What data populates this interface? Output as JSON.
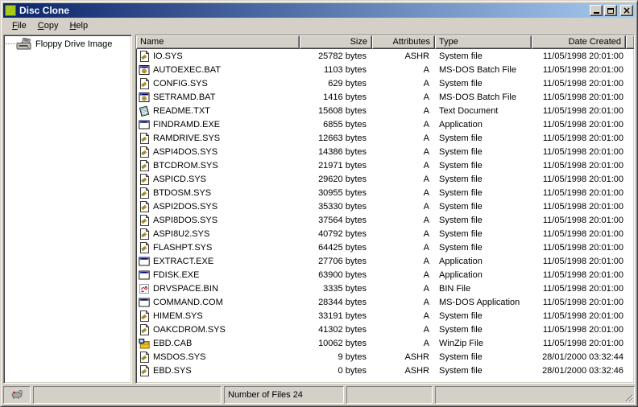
{
  "window": {
    "title": "Disc Clone"
  },
  "titlebar": {
    "buttons": {
      "minimize": "minimize",
      "maximize": "maximize",
      "close": "close"
    }
  },
  "menu": {
    "items": [
      {
        "label": "File"
      },
      {
        "label": "Copy"
      },
      {
        "label": "Help"
      }
    ]
  },
  "tree": {
    "items": [
      {
        "label": "Floppy Drive Image",
        "icon": "floppy-drive-icon"
      }
    ]
  },
  "list": {
    "columns": [
      {
        "label": "Name",
        "align": "left"
      },
      {
        "label": "Size",
        "align": "right"
      },
      {
        "label": "Attributes",
        "align": "right"
      },
      {
        "label": "Type",
        "align": "left"
      },
      {
        "label": "Date Created",
        "align": "right"
      }
    ],
    "files": [
      {
        "name": "IO.SYS",
        "size": "25782 bytes",
        "attributes": "ASHR",
        "type": "System file",
        "date": "11/05/1998 20:01:00",
        "icon": "system-file-icon"
      },
      {
        "name": "AUTOEXEC.BAT",
        "size": "1103 bytes",
        "attributes": "A",
        "type": "MS-DOS Batch File",
        "date": "11/05/1998 20:01:00",
        "icon": "msdos-batch-file-icon"
      },
      {
        "name": "CONFIG.SYS",
        "size": "629 bytes",
        "attributes": "A",
        "type": "System file",
        "date": "11/05/1998 20:01:00",
        "icon": "system-file-icon"
      },
      {
        "name": "SETRAMD.BAT",
        "size": "1416 bytes",
        "attributes": "A",
        "type": "MS-DOS Batch File",
        "date": "11/05/1998 20:01:00",
        "icon": "msdos-batch-file-icon"
      },
      {
        "name": "README.TXT",
        "size": "15608 bytes",
        "attributes": "A",
        "type": "Text Document",
        "date": "11/05/1998 20:01:00",
        "icon": "text-document-icon"
      },
      {
        "name": "FINDRAMD.EXE",
        "size": "6855 bytes",
        "attributes": "A",
        "type": "Application",
        "date": "11/05/1998 20:01:00",
        "icon": "msdos-application-icon"
      },
      {
        "name": "RAMDRIVE.SYS",
        "size": "12663 bytes",
        "attributes": "A",
        "type": "System file",
        "date": "11/05/1998 20:01:00",
        "icon": "system-file-icon"
      },
      {
        "name": "ASPI4DOS.SYS",
        "size": "14386 bytes",
        "attributes": "A",
        "type": "System file",
        "date": "11/05/1998 20:01:00",
        "icon": "system-file-icon"
      },
      {
        "name": "BTCDROM.SYS",
        "size": "21971 bytes",
        "attributes": "A",
        "type": "System file",
        "date": "11/05/1998 20:01:00",
        "icon": "system-file-icon"
      },
      {
        "name": "ASPICD.SYS",
        "size": "29620 bytes",
        "attributes": "A",
        "type": "System file",
        "date": "11/05/1998 20:01:00",
        "icon": "system-file-icon"
      },
      {
        "name": "BTDOSM.SYS",
        "size": "30955 bytes",
        "attributes": "A",
        "type": "System file",
        "date": "11/05/1998 20:01:00",
        "icon": "system-file-icon"
      },
      {
        "name": "ASPI2DOS.SYS",
        "size": "35330 bytes",
        "attributes": "A",
        "type": "System file",
        "date": "11/05/1998 20:01:00",
        "icon": "system-file-icon"
      },
      {
        "name": "ASPI8DOS.SYS",
        "size": "37564 bytes",
        "attributes": "A",
        "type": "System file",
        "date": "11/05/1998 20:01:00",
        "icon": "system-file-icon"
      },
      {
        "name": "ASPI8U2.SYS",
        "size": "40792 bytes",
        "attributes": "A",
        "type": "System file",
        "date": "11/05/1998 20:01:00",
        "icon": "system-file-icon"
      },
      {
        "name": "FLASHPT.SYS",
        "size": "64425 bytes",
        "attributes": "A",
        "type": "System file",
        "date": "11/05/1998 20:01:00",
        "icon": "system-file-icon"
      },
      {
        "name": "EXTRACT.EXE",
        "size": "27706 bytes",
        "attributes": "A",
        "type": "Application",
        "date": "11/05/1998 20:01:00",
        "icon": "msdos-application-icon"
      },
      {
        "name": "FDISK.EXE",
        "size": "63900 bytes",
        "attributes": "A",
        "type": "Application",
        "date": "11/05/1998 20:01:00",
        "icon": "msdos-application-icon"
      },
      {
        "name": "DRVSPACE.BIN",
        "size": "3335 bytes",
        "attributes": "A",
        "type": "BIN File",
        "date": "11/05/1998 20:01:00",
        "icon": "bin-file-icon"
      },
      {
        "name": "COMMAND.COM",
        "size": "28344 bytes",
        "attributes": "A",
        "type": "MS-DOS Application",
        "date": "11/05/1998 20:01:00",
        "icon": "msdos-application-icon"
      },
      {
        "name": "HIMEM.SYS",
        "size": "33191 bytes",
        "attributes": "A",
        "type": "System file",
        "date": "11/05/1998 20:01:00",
        "icon": "system-file-icon"
      },
      {
        "name": "OAKCDROM.SYS",
        "size": "41302 bytes",
        "attributes": "A",
        "type": "System file",
        "date": "11/05/1998 20:01:00",
        "icon": "system-file-icon"
      },
      {
        "name": "EBD.CAB",
        "size": "10062 bytes",
        "attributes": "A",
        "type": "WinZip File",
        "date": "11/05/1998 20:01:00",
        "icon": "winzip-file-icon"
      },
      {
        "name": "MSDOS.SYS",
        "size": "9 bytes",
        "attributes": "ASHR",
        "type": "System file",
        "date": "28/01/2000 03:32:44",
        "icon": "system-file-icon"
      },
      {
        "name": "EBD.SYS",
        "size": "0 bytes",
        "attributes": "ASHR",
        "type": "System file",
        "date": "28/01/2000 03:32:46",
        "icon": "system-file-icon"
      }
    ]
  },
  "statusbar": {
    "file_count_label": "Number of Files 24"
  },
  "colors": {
    "titlebar_gradient_start": "#0A246A",
    "titlebar_gradient_end": "#A6CAF0",
    "chrome": "#D4D0C8",
    "app_icon_green": "#A4CB1A"
  }
}
